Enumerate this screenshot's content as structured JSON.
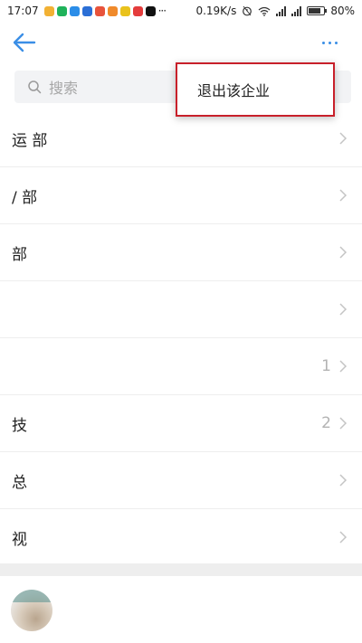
{
  "status_bar": {
    "time": "17:07",
    "notification_icons": [
      "app-icon",
      "app-icon",
      "app-icon",
      "app-icon",
      "app-icon",
      "app-icon",
      "app-icon",
      "app-icon",
      "tiktok-icon"
    ],
    "overflow": "···",
    "network_speed": "0.19K/s",
    "battery": "80%",
    "battery_level": 0.8
  },
  "nav": {
    "back_icon": "arrow-left-icon",
    "more_icon": "more-dots-icon",
    "accent": "#3a8ee6"
  },
  "search": {
    "placeholder": "搜索"
  },
  "departments": [
    {
      "name": "运 部",
      "count": ""
    },
    {
      "name": "/ 部",
      "count": ""
    },
    {
      "name": "部",
      "count": ""
    },
    {
      "name": "",
      "count": ""
    },
    {
      "name": "",
      "count": "1"
    },
    {
      "name": "技",
      "count": "2"
    },
    {
      "name": "总",
      "count": ""
    },
    {
      "name": "视 ",
      "count": ""
    }
  ],
  "popup_menu": {
    "items": [
      "退出该企业"
    ],
    "highlight_color": "#c8202a"
  }
}
